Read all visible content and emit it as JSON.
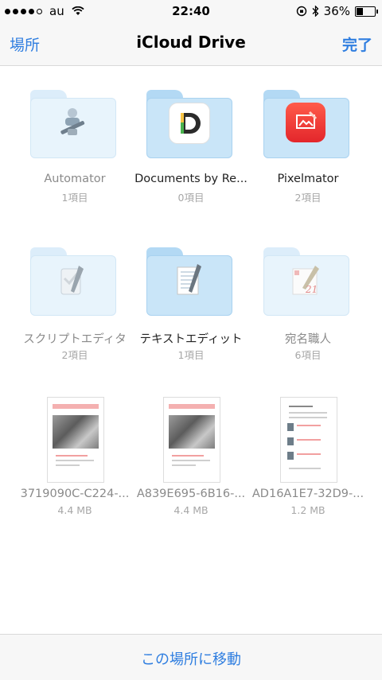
{
  "status": {
    "carrier": "au",
    "time": "22:40",
    "battery": "36%",
    "battery_level": 0.36
  },
  "nav": {
    "back": "場所",
    "title": "iCloud Drive",
    "done": "完了"
  },
  "items": [
    {
      "name": "Automator",
      "sub": "1項目",
      "icon": "automator-icon"
    },
    {
      "name": "Documents by Re...",
      "sub": "0項目",
      "icon": "documents-icon"
    },
    {
      "name": "Pixelmator",
      "sub": "2項目",
      "icon": "pixelmator-icon"
    },
    {
      "name": "スクリプトエディタ",
      "sub": "2項目",
      "icon": "script-editor-icon"
    },
    {
      "name": "テキストエディット",
      "sub": "1項目",
      "icon": "textedit-icon"
    },
    {
      "name": "宛名職人",
      "sub": "6項目",
      "icon": "atena-icon"
    },
    {
      "name": "3719090C-C224-...",
      "sub": "4.4 MB",
      "icon": "pdf-thumbnail"
    },
    {
      "name": "A839E695-6B16-...",
      "sub": "4.4 MB",
      "icon": "pdf-thumbnail"
    },
    {
      "name": "AD16A1E7-32D9-...",
      "sub": "1.2 MB",
      "icon": "pdf-thumbnail"
    }
  ],
  "bottom": {
    "action": "この場所に移動"
  },
  "colors": {
    "accent": "#2f7ee0"
  }
}
